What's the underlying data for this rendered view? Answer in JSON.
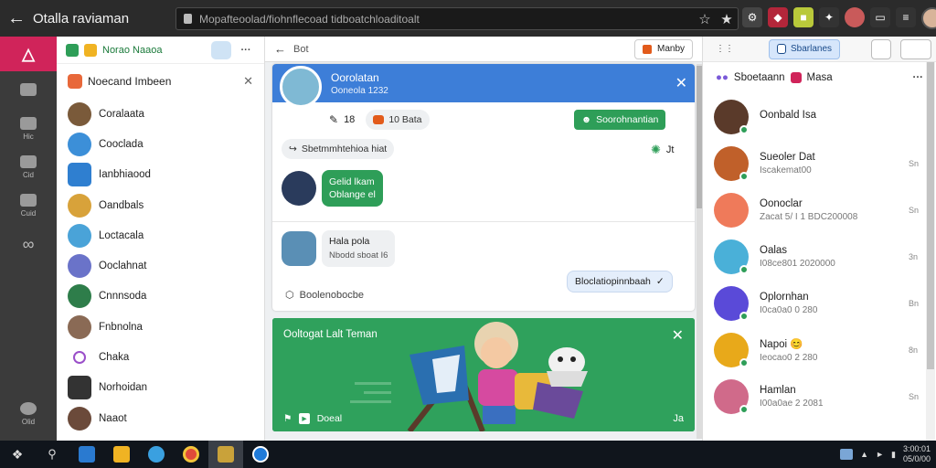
{
  "browser": {
    "app_title": "Otalla raviaman",
    "url": "Mopafteoolad/fiohnflecoad tidboatchloaditoalt"
  },
  "rail": {
    "items": [
      {
        "label": "",
        "icon": "list-icon"
      },
      {
        "label": "Hic",
        "icon": "home-icon"
      },
      {
        "label": "Cid",
        "icon": "chat-icon"
      },
      {
        "label": "Cuid",
        "icon": "smile-icon"
      },
      {
        "label": "",
        "icon": "infinity-icon"
      }
    ],
    "bottom": {
      "label": "Olid",
      "icon": "help-icon"
    }
  },
  "contacts": {
    "header_name": "Norao Naaoa",
    "section_title": "Noecand Imbeen",
    "items": [
      {
        "name": "Coralaata",
        "color": "#7a5a3a"
      },
      {
        "name": "Cooclada",
        "color": "#3c8fd8"
      },
      {
        "name": "Ianbhiaood",
        "color": "#2f7fd0"
      },
      {
        "name": "Oandbals",
        "color": "#d8a23a"
      },
      {
        "name": "Loctacala",
        "color": "#4aa3d8"
      },
      {
        "name": "Ooclahnat",
        "color": "#6a73c9"
      },
      {
        "name": "Cnnnsoda",
        "color": "#2e7d4a"
      },
      {
        "name": "Fnbnolna",
        "color": "#8a6a55"
      },
      {
        "name": "Chaka",
        "color": "#9a4fc9"
      },
      {
        "name": "Norhoidan",
        "color": "#333333"
      },
      {
        "name": "Naaot",
        "color": "#6b4a3a"
      }
    ]
  },
  "main": {
    "title": "Bot",
    "header_button": "Manby",
    "chat": {
      "name": "Oorolatan",
      "status": "Ooneola 1232",
      "stats_likes": "18",
      "stats_count": "10 Bata",
      "action_button": "Soorohnantian",
      "forward_chip": "Sbetmmhtehioa hiat",
      "reaction_count": "Jt",
      "bubble_line1": "Gelid lkam",
      "bubble_line2": "Oblange el",
      "reply_name": "Hala pola",
      "reply_sub": "Nbodd sboat I6",
      "reply_button": "Bloclatiopinnbaah",
      "footer_text": "Boolenobocbe"
    },
    "media": {
      "title": "Ooltogat Lalt Teman",
      "footer_label": "Doeal",
      "expand": "Ja"
    }
  },
  "right": {
    "top_button": "Sbarlanes",
    "header": "Sboetaann",
    "header_badge": "Masa",
    "items": [
      {
        "name": "Oonbald Isa",
        "sub": "",
        "time": "",
        "color": "#5a3a2a"
      },
      {
        "name": "Sueoler Dat",
        "sub": "Iscakemat00",
        "time": "Sn",
        "color": "#c0602a"
      },
      {
        "name": "Oonoclar",
        "sub": "Zacat 5/ I 1 BDC200008",
        "time": "Sn",
        "color": "#ef7a5a"
      },
      {
        "name": "Oalas",
        "sub": "I08ce801 2020000",
        "time": "3n",
        "color": "#4ab0d8"
      },
      {
        "name": "Oplornhan",
        "sub": "I0ca0a0 0 280",
        "time": "Bn",
        "color": "#5a4ad8"
      },
      {
        "name": "Napoi 😊",
        "sub": "Ieocao0 2 280",
        "time": "8n",
        "color": "#e8a91a"
      },
      {
        "name": "Hamlan",
        "sub": "I00a0ae 2 2081",
        "time": "Sn",
        "color": "#d06a8a"
      }
    ]
  },
  "taskbar": {
    "clock_time": "3:00:01",
    "clock_date": "05/0/00"
  },
  "colors": {
    "accent_blue": "#3d7ed8",
    "accent_green": "#2e9e58",
    "brand_pink": "#d0245a"
  }
}
